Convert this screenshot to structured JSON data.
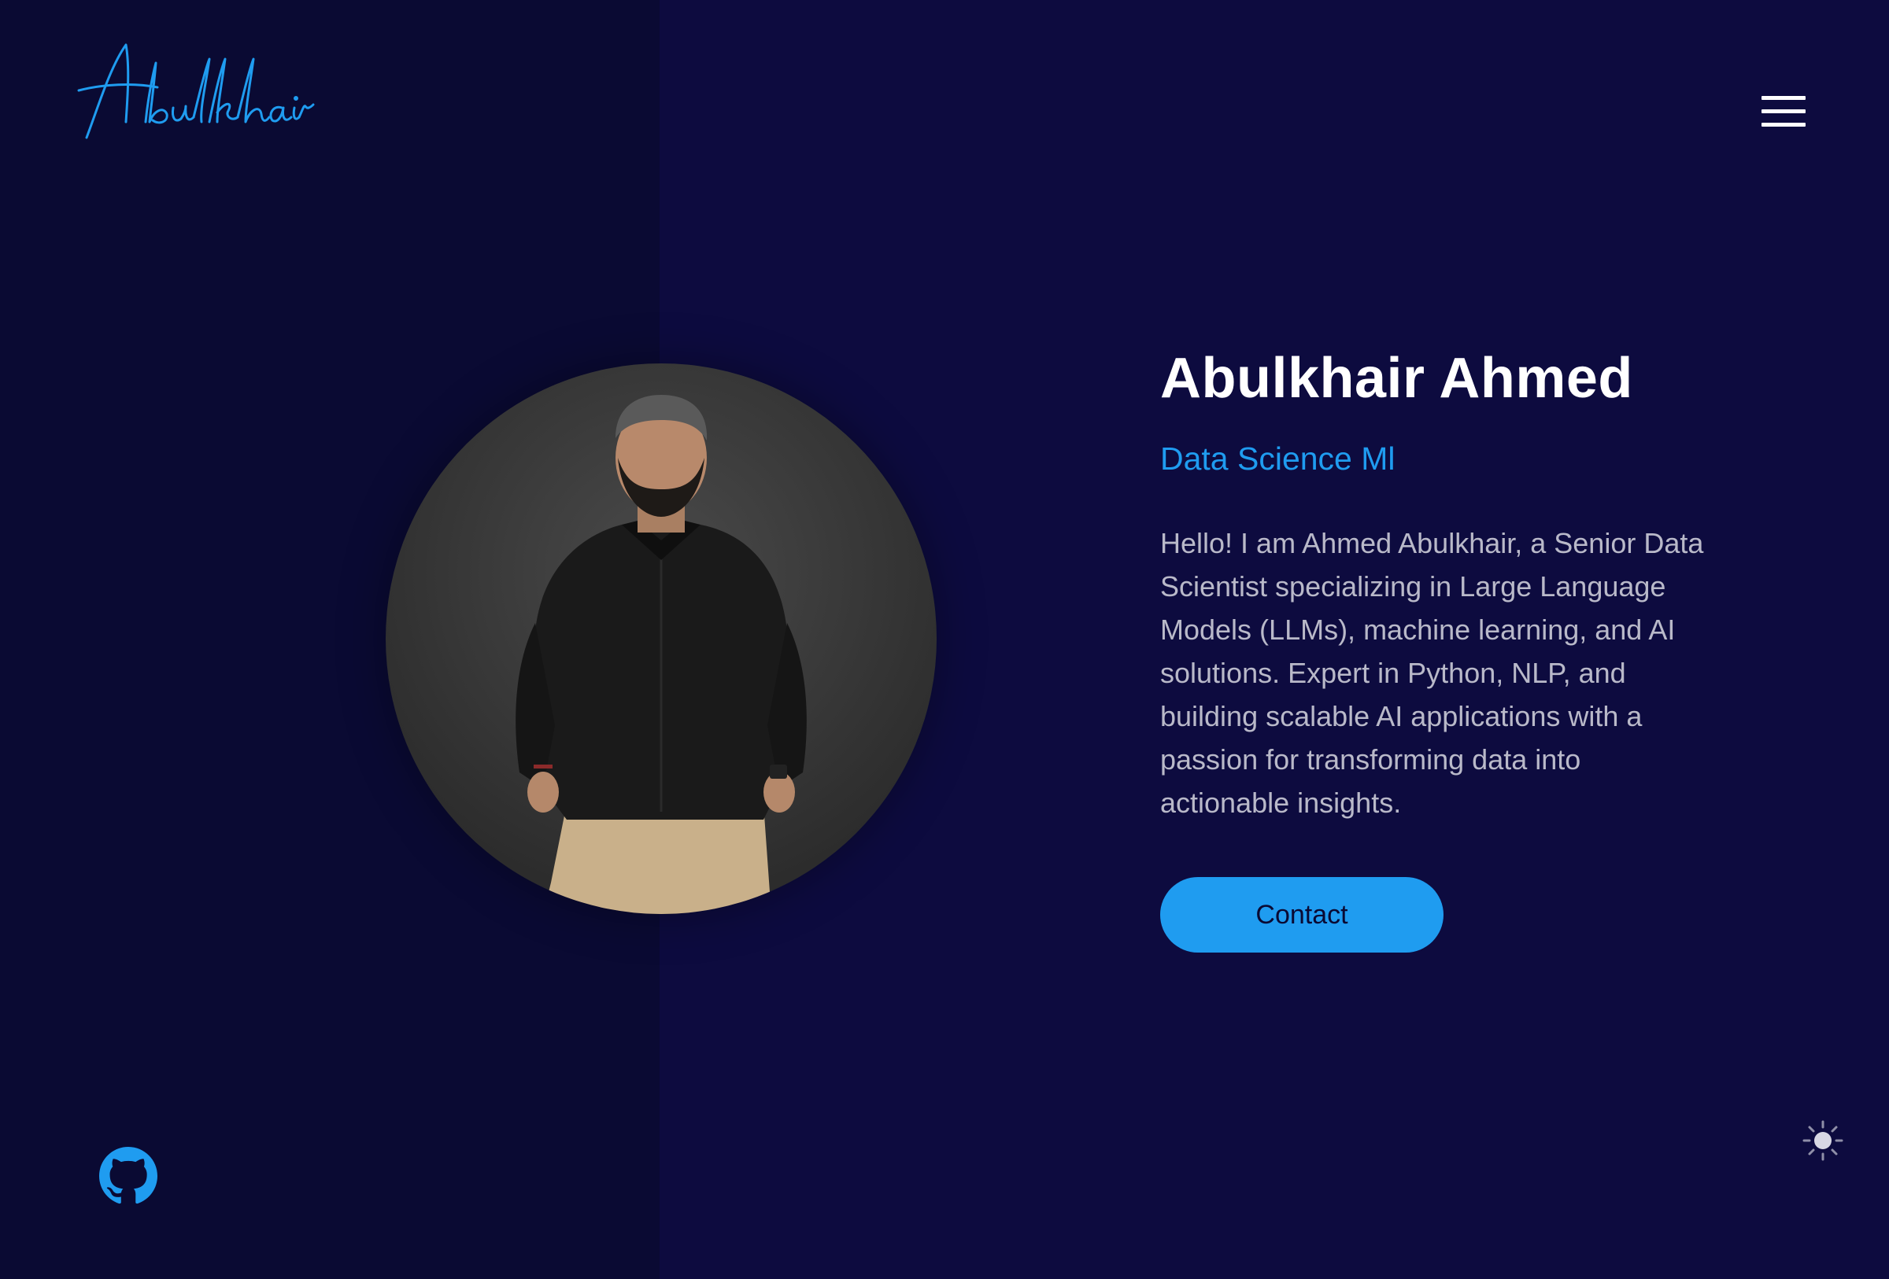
{
  "header": {
    "logo_text": "Abulkhair",
    "menu_icon": "hamburger-menu-icon"
  },
  "hero": {
    "name": "Abulkhair Ahmed",
    "role": "Data Science Ml",
    "bio": "Hello! I am Ahmed Abulkhair, a Senior Data Scientist specializing in Large Language Models (LLMs), machine learning, and AI solutions. Expert in Python, NLP, and building scalable AI applications with a passion for transforming data into actionable insights.",
    "contact_label": "Contact"
  },
  "social": {
    "github_icon": "github-icon"
  },
  "theme": {
    "toggle_icon": "sun-icon"
  },
  "colors": {
    "background": "#0d0b3f",
    "left_panel": "#0a0a33",
    "accent": "#1f9cf0",
    "heading": "#ffffff",
    "body_text": "#b9b9c9"
  }
}
